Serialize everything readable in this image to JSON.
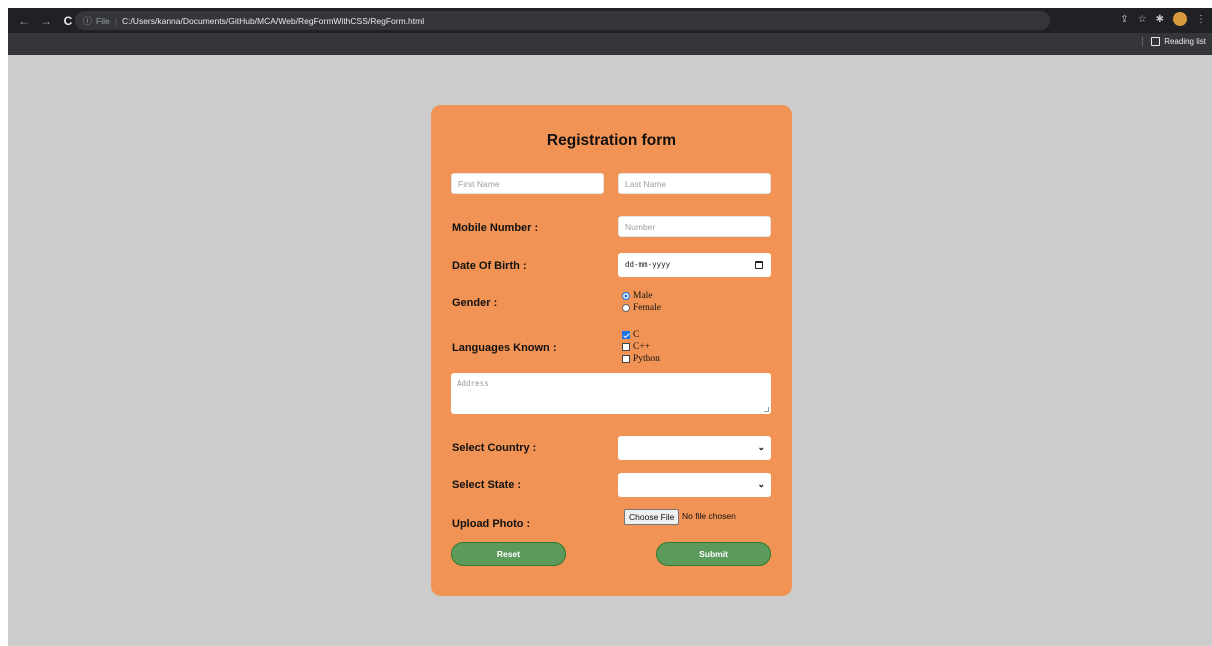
{
  "browser": {
    "back_icon": "←",
    "forward_icon": "→",
    "reload_icon": "C",
    "info_icon": "ⓘ",
    "scheme": "File",
    "url": "C:/Users/kanna/Documents/GitHub/MCA/Web/RegFormWithCSS/RegForm.html",
    "share_icon": "⇪",
    "star_icon": "☆",
    "extensions_icon": "✱",
    "menu_icon": "⋮",
    "reading_list": "Reading list"
  },
  "form": {
    "title": "Registration form",
    "first_name_placeholder": "First Name",
    "last_name_placeholder": "Last Name",
    "mobile_label": "Mobile Number :",
    "mobile_placeholder": "Number",
    "dob_label": "Date Of Birth :",
    "dob_placeholder": "dd-mm-yyyy",
    "gender_label": "Gender :",
    "gender_options": [
      {
        "label": "Male",
        "selected": true
      },
      {
        "label": "Female",
        "selected": false
      }
    ],
    "languages_label": "Languages Known :",
    "languages": [
      {
        "label": "C",
        "checked": true
      },
      {
        "label": "C++",
        "checked": false
      },
      {
        "label": "Python",
        "checked": false
      }
    ],
    "address_placeholder": "Address",
    "country_label": "Select Country :",
    "country_value": "",
    "state_label": "Select State :",
    "state_value": "",
    "photo_label": "Upload Photo :",
    "choose_file": "Choose File",
    "no_file": "No file chosen",
    "reset_label": "Reset",
    "submit_label": "Submit"
  },
  "colors": {
    "card": "#f09354",
    "page_bg": "#cccccc",
    "button": "#5c9a5b",
    "accent": "#1a73e8"
  }
}
